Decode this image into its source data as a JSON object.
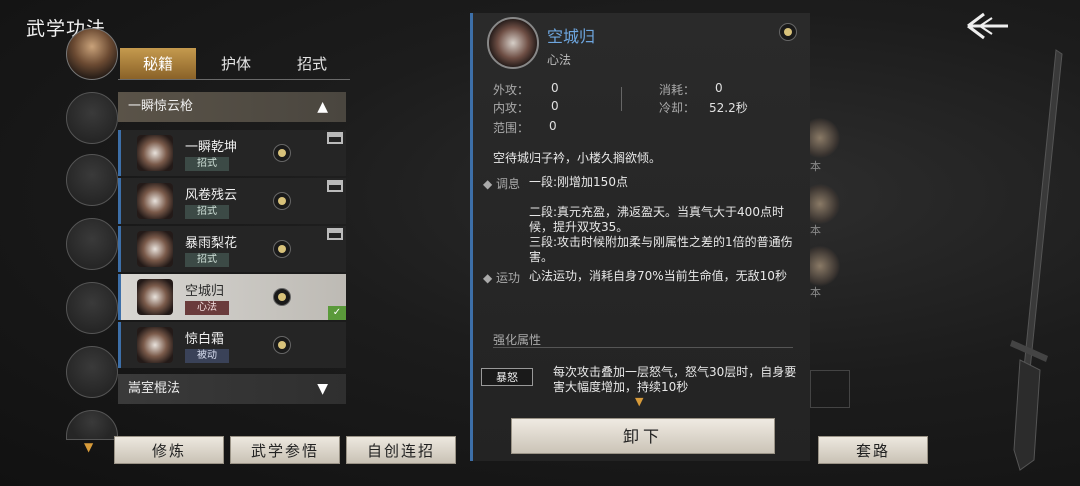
{
  "title": "武学功法",
  "tabs": [
    "秘籍",
    "护体",
    "招式"
  ],
  "groups": {
    "expanded": "一瞬惊云枪",
    "collapsed": "嵩室棍法"
  },
  "skills": [
    {
      "name": "一瞬乾坤",
      "tag": "招式"
    },
    {
      "name": "风卷残云",
      "tag": "招式"
    },
    {
      "name": "暴雨梨花",
      "tag": "招式"
    },
    {
      "name": "空城归",
      "tag": "心法"
    },
    {
      "name": "惊白霜",
      "tag": "被动"
    }
  ],
  "buttons": {
    "train": "修炼",
    "insight": "武学参悟",
    "combo": "自创连招",
    "routine": "套路",
    "unequip": "卸下"
  },
  "detail": {
    "name": "空城归",
    "type": "心法",
    "stats": {
      "waigong_label": "外攻：",
      "waigong": "0",
      "neigong_label": "内攻：",
      "neigong": "0",
      "range_label": "范围：",
      "range": "0",
      "cost_label": "消耗：",
      "cost": "0",
      "cooldown_label": "冷却：",
      "cooldown": "52.2秒"
    },
    "desc": "空待城归子衿，小楼久搁欲倾。",
    "tiaoxi_label": "◆ 调息",
    "tiaoxi_1": "一段:刚增加150点",
    "tiaoxi_2": "二段:真元充盈，沸返盈天。当真气大于400点时候，提升双攻35。",
    "tiaoxi_3": "三段:攻击时候附加柔与刚属性之差的1倍的普通伤害。",
    "yungong_label": "◆ 运功",
    "yungong": "心法运功，消耗自身70%当前生命值，无敌10秒",
    "enh_title": "强化属性",
    "enh_badge": "暴怒",
    "enh_text": "每次攻击叠加一层怒气，怒气30层时，自身要害大幅度增加，持续10秒"
  },
  "bg_labels": [
    "本",
    "本",
    "本"
  ]
}
